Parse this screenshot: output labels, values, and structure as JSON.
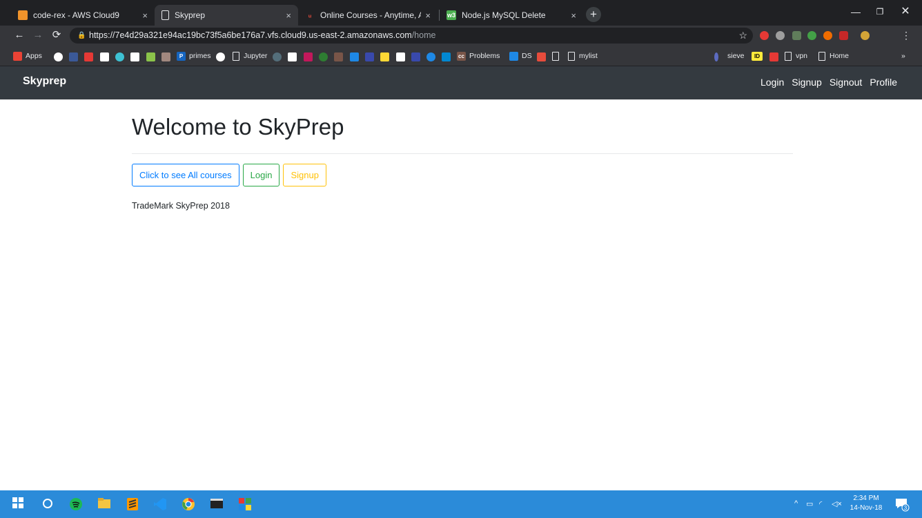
{
  "browser": {
    "tabs": [
      {
        "title": "code-rex - AWS Cloud9",
        "close": "×"
      },
      {
        "title": "Skyprep",
        "close": "×"
      },
      {
        "title": "Online Courses - Anytime, Anywh",
        "close": "×"
      },
      {
        "title": "Node.js MySQL Delete",
        "close": "×"
      }
    ],
    "new_tab": "+",
    "url_main": "https://7e4d29a321e94ac19bc73f5a6be176a7.vfs.cloud9.us-east-2.amazonaws.com",
    "url_path": "/home",
    "bookmarks": {
      "apps": "Apps",
      "primes": "primes",
      "jupyter": "Jupyter",
      "problems": "Problems",
      "ds": "DS",
      "mylist": "mylist",
      "sieve": "sieve",
      "vpn": "vpn",
      "home": "Home",
      "more": "»"
    }
  },
  "site": {
    "brand": "Skyprep",
    "nav": [
      "Login",
      "Signup",
      "Signout",
      "Profile"
    ],
    "heading": "Welcome to SkyPrep",
    "buttons": {
      "courses": "Click to see All courses",
      "login": "Login",
      "signup": "Signup"
    },
    "footer": "TradeMark SkyPrep 2018"
  },
  "taskbar": {
    "time": "2:34 PM",
    "date": "14-Nov-18",
    "notifications": "3"
  },
  "colors": {
    "navbar": "#343a40",
    "info": "#007bff",
    "success": "#28a745",
    "warning": "#ffc107",
    "taskbar": "#2b8bd9"
  }
}
